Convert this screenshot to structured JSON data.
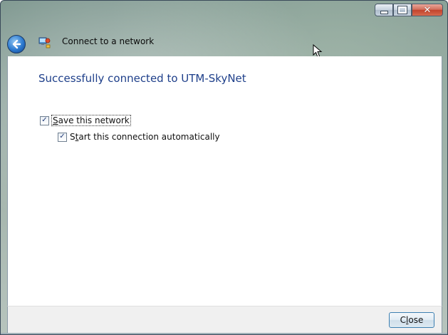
{
  "window": {
    "title": "Connect to a network",
    "caption_buttons": {
      "minimize_icon": "minimize-icon",
      "maximize_icon": "maximize-icon",
      "close_icon": "close-icon",
      "close_glyph": "✕"
    }
  },
  "nav": {
    "back_icon": "back-arrow-icon",
    "app_icon": "network-icon"
  },
  "main": {
    "heading": "Successfully connected to UTM-SkyNet",
    "options": [
      {
        "pre": "",
        "accel": "S",
        "post": "ave this network",
        "checked": true
      },
      {
        "pre": "S",
        "accel": "t",
        "post": "art this connection automatically",
        "checked": true
      }
    ],
    "check_glyph": "✓"
  },
  "footer": {
    "close_pre": "C",
    "close_accel": "l",
    "close_post": "ose"
  },
  "colors": {
    "heading": "#1e3f8a",
    "close_button_border": "#3c7fb1",
    "caption_close": "#c2432c"
  }
}
